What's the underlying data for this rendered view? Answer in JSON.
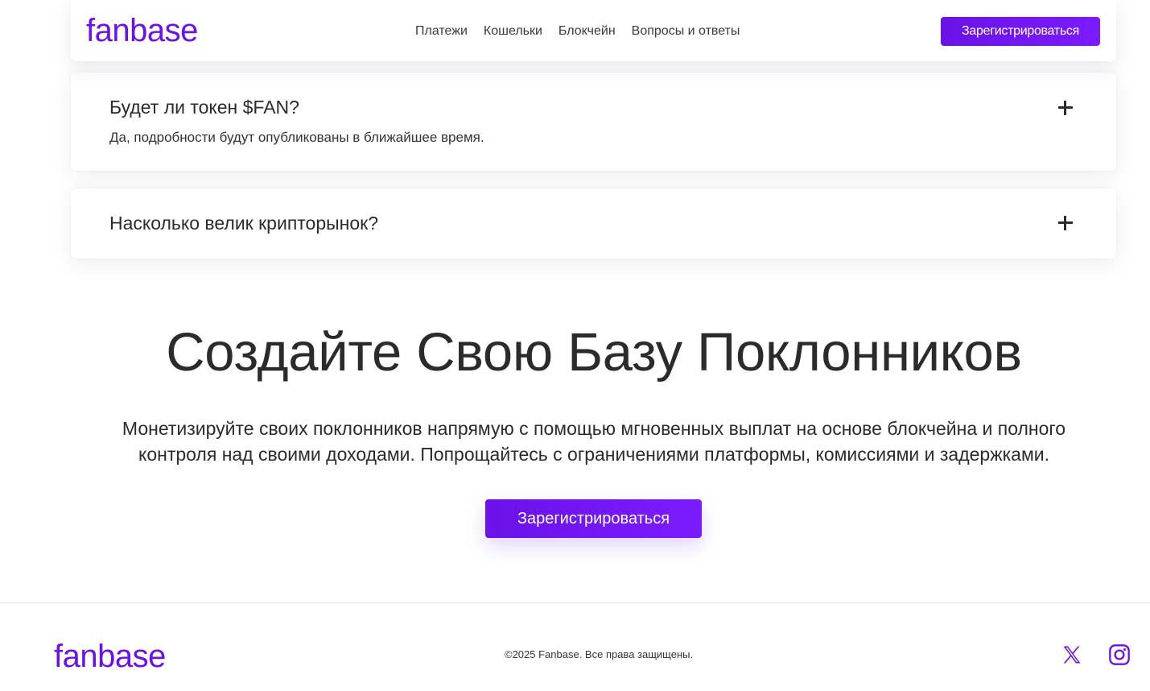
{
  "header": {
    "logo": "fanbase",
    "nav": [
      "Платежи",
      "Кошельки",
      "Блокчейн",
      "Вопросы и ответы"
    ],
    "signup_label": "Зарегистрироваться"
  },
  "faq": [
    {
      "question": "Будет ли токен $FAN?",
      "answer": "Да, подробности будут опубликованы в ближайшее время.",
      "expanded": true,
      "toggle_icon": "plus-icon"
    },
    {
      "question": "Насколько велик крипторынок?",
      "expanded": false,
      "toggle_icon": "plus-icon"
    }
  ],
  "cta": {
    "title": "Создайте Свою Базу Поклонников",
    "subtitle_line1": "Монетизируйте своих поклонников напрямую с помощью мгновенных выплат на основе блокчейна и полного",
    "subtitle_line2": "контроля над своими доходами. Попрощайтесь с ограничениями платформы, комиссиями и задержками.",
    "button_label": "Зарегистрироваться"
  },
  "footer": {
    "logo": "fanbase",
    "copyright": "©2025 Fanbase. Все права защищены.",
    "social": [
      "x-icon",
      "instagram-icon"
    ]
  },
  "colors": {
    "brand": "#6a12e8",
    "text": "#2b2b2b",
    "background": "#ffffff"
  }
}
